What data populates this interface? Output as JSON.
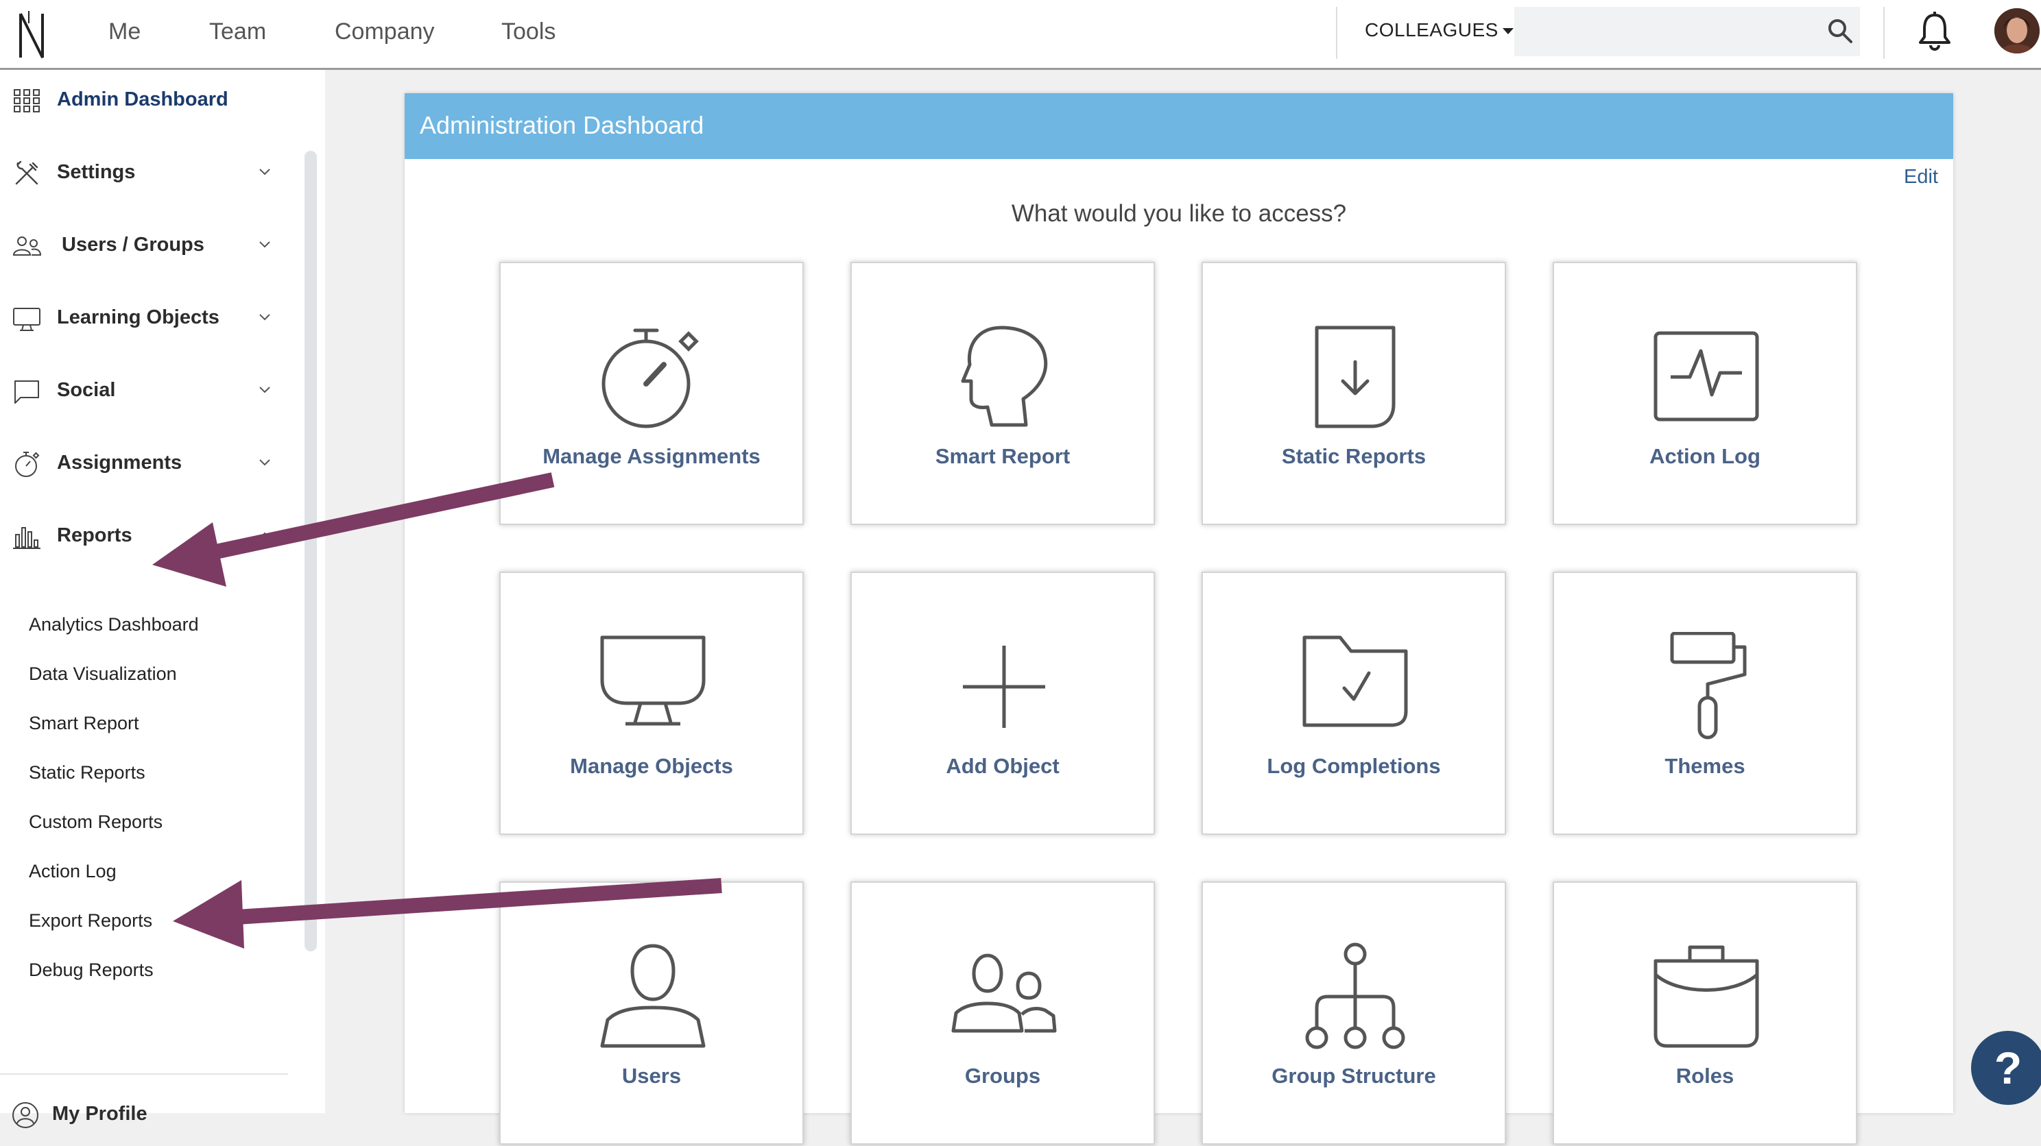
{
  "topnav": {
    "items": [
      "Me",
      "Team",
      "Company",
      "Tools"
    ],
    "colleagues_label": "COLLEAGUES",
    "search_placeholder": ""
  },
  "sidebar": {
    "items": [
      {
        "label": "Admin Dashboard",
        "icon": "grid-icon"
      },
      {
        "label": "Settings",
        "icon": "tools-icon"
      },
      {
        "label": "Users / Groups",
        "icon": "users-icon"
      },
      {
        "label": "Learning Objects",
        "icon": "monitor-icon"
      },
      {
        "label": "Social",
        "icon": "chat-icon"
      },
      {
        "label": "Assignments",
        "icon": "stopwatch-icon"
      },
      {
        "label": "Reports",
        "icon": "bar-chart-icon"
      }
    ],
    "report_subitems": [
      "Analytics Dashboard",
      "Data Visualization",
      "Smart Report",
      "Static Reports",
      "Custom Reports",
      "Action Log",
      "Export Reports",
      "Debug Reports"
    ],
    "profile_label": "My Profile"
  },
  "main": {
    "title": "Administration Dashboard",
    "edit_label": "Edit",
    "question": "What would you like to access?",
    "tiles": [
      {
        "label": "Manage Assignments",
        "icon": "stopwatch-icon"
      },
      {
        "label": "Smart Report",
        "icon": "head-icon"
      },
      {
        "label": "Static Reports",
        "icon": "download-document-icon"
      },
      {
        "label": "Action Log",
        "icon": "activity-monitor-icon"
      },
      {
        "label": "Manage Objects",
        "icon": "monitor-icon"
      },
      {
        "label": "Add Object",
        "icon": "plus-icon"
      },
      {
        "label": "Log Completions",
        "icon": "folder-check-icon"
      },
      {
        "label": "Themes",
        "icon": "paint-roller-icon"
      },
      {
        "label": "Users",
        "icon": "user-icon"
      },
      {
        "label": "Groups",
        "icon": "group-icon"
      },
      {
        "label": "Group Structure",
        "icon": "hierarchy-icon"
      },
      {
        "label": "Roles",
        "icon": "briefcase-icon"
      }
    ]
  },
  "help_label": "?",
  "colors": {
    "header_blue": "#6fb6e2",
    "tile_label": "#4a6287",
    "arrow": "#7c3b63",
    "help_button": "#284a72"
  }
}
